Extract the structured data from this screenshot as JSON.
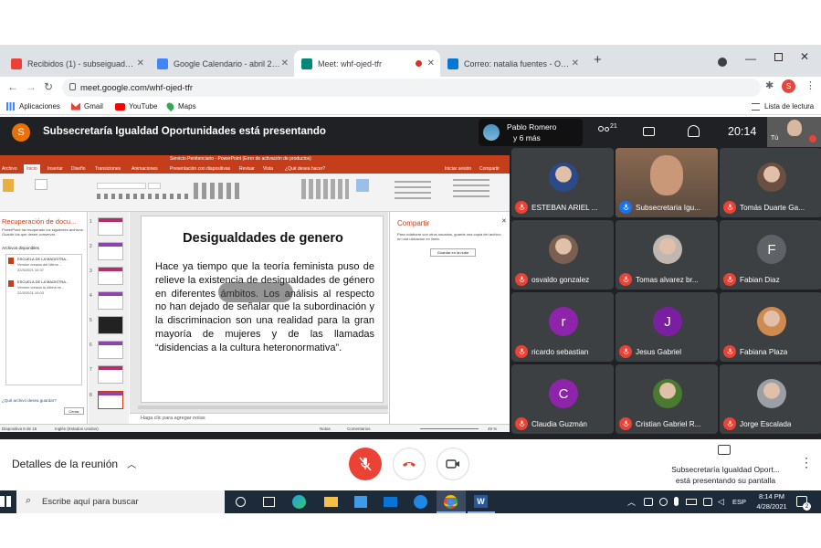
{
  "browser": {
    "tabs": [
      {
        "label": "Recibidos (1) - subseiguadadop",
        "icon": "gmail-icon",
        "color": "#ea4335"
      },
      {
        "label": "Google Calendario - abril 2021",
        "icon": "calendar-icon",
        "color": "#4285f4"
      },
      {
        "label": "Meet: whf-ojed-tfr",
        "icon": "meet-icon",
        "color": "#00897b"
      },
      {
        "label": "Correo: natalia fuentes - Outlook",
        "icon": "outlook-icon",
        "color": "#0078d4"
      }
    ],
    "url": "meet.google.com/whf-ojed-tfr",
    "profile_initial": "S",
    "bookmarks": [
      "Aplicaciones",
      "Gmail",
      "YouTube",
      "Maps"
    ],
    "reading_list": "Lista de lectura"
  },
  "meet": {
    "presenter_initial": "S",
    "presenting_title": "Subsecretaría Igualdad Oportunidades está presentando",
    "pinned_name": "Pablo Romero",
    "pinned_more": "y 6 más",
    "participant_count": "21",
    "clock": "20:14",
    "self_label": "Tú",
    "participants": [
      {
        "name": "ESTEBAN ARIEL ...",
        "type": "photo",
        "color": "#2b4a8a"
      },
      {
        "name": "Subsecretaria Igu...",
        "type": "photo",
        "color": "#8a5a3a"
      },
      {
        "name": "Tomás Duarte Ga...",
        "type": "photo",
        "color": "#6a5040"
      },
      {
        "name": "osvaldo gonzalez",
        "type": "photo",
        "color": "#7a6050"
      },
      {
        "name": "Tomas alvarez br...",
        "type": "photo",
        "color": "#c0b8b0"
      },
      {
        "name": "Fabian Diaz",
        "type": "letter",
        "initial": "F",
        "color": "#5f6368"
      },
      {
        "name": "ricardo sebastian",
        "type": "letter",
        "initial": "r",
        "color": "#8e24aa"
      },
      {
        "name": "Jesus Gabriel",
        "type": "letter",
        "initial": "J",
        "color": "#7b1fa2"
      },
      {
        "name": "Fabiana Plaza",
        "type": "photo",
        "color": "#d08a50"
      },
      {
        "name": "Claudia Guzmán",
        "type": "letter",
        "initial": "C",
        "color": "#8e24aa"
      },
      {
        "name": "Cristian Gabriel R...",
        "type": "photo",
        "color": "#4a7a30"
      },
      {
        "name": "Jorge Escalada",
        "type": "photo",
        "color": "#9aa0a6"
      }
    ],
    "meeting_details": "Detalles de la reunión",
    "presenting_footer_1": "Subsecretaría Igualdad Oport...",
    "presenting_footer_2": "está presentando su pantalla"
  },
  "ppt": {
    "window_title": "Servicio Penitenciario - PowerPoint (Error de activación de productos)",
    "ribbon_tabs": [
      "Archivo",
      "Inicio",
      "Insertar",
      "Diseño",
      "Transiciones",
      "Animaciones",
      "Presentación con diapositivas",
      "Revisar",
      "Vista",
      "¿Qué desea hacer?"
    ],
    "signin": "Iniciar sesión",
    "share": "Compartir",
    "recovery_title": "Recuperación de docu...",
    "recovery_desc": "PowerPoint ha recuperado los siguientes archivos. Guarde los que desee conservar.",
    "recovery_available": "Archivos disponibles",
    "recovery_files": [
      {
        "name": "ESCUELA DE LA MAGISTRA...",
        "detail": "Versión creada del último ...",
        "date": "22/3/2021 10:37"
      },
      {
        "name": "ESCUELA DE LA MAGISTRA...",
        "detail": "Versión creada la última ve...",
        "date": "22/3/2021 10:03"
      }
    ],
    "recovery_link": "¿Qué archivo desea guardar?",
    "recovery_close": "Cerrar",
    "slide_title": "Desigualdades de genero",
    "slide_body": "Hace ya tiempo que la teoría feminista puso de relieve la existencia de desigualdades de género en diferentes ámbitos. Los análisis al respecto no han dejado de señalar que la subordinación y la discriminacion son una realidad para la gran mayoría de mujeres y de las llamadas “disidencias a la cultura heteronormativa”.",
    "notes_placeholder": "Haga clic para agregar notas",
    "share_panel_title": "Compartir",
    "share_panel_text": "Para colaborar con otros usuarios, guarde una copia del archivo en una ubicación en línea.",
    "share_panel_button": "Guardar en la nube",
    "status_slide": "Diapositiva 8 de 15",
    "status_lang": "Inglés (Estados Unidos)",
    "status_notes": "Notas",
    "status_comments": "Comentarios",
    "zoom": "49 %",
    "current_slide_number": "8",
    "slide_numbers": [
      "1",
      "2",
      "3",
      "4",
      "5",
      "6",
      "7",
      "8"
    ]
  },
  "taskbar": {
    "search_placeholder": "Escribe aquí para buscar",
    "lang": "ESP",
    "time": "8:14 PM",
    "date": "4/28/2021",
    "notif_count": "2"
  }
}
